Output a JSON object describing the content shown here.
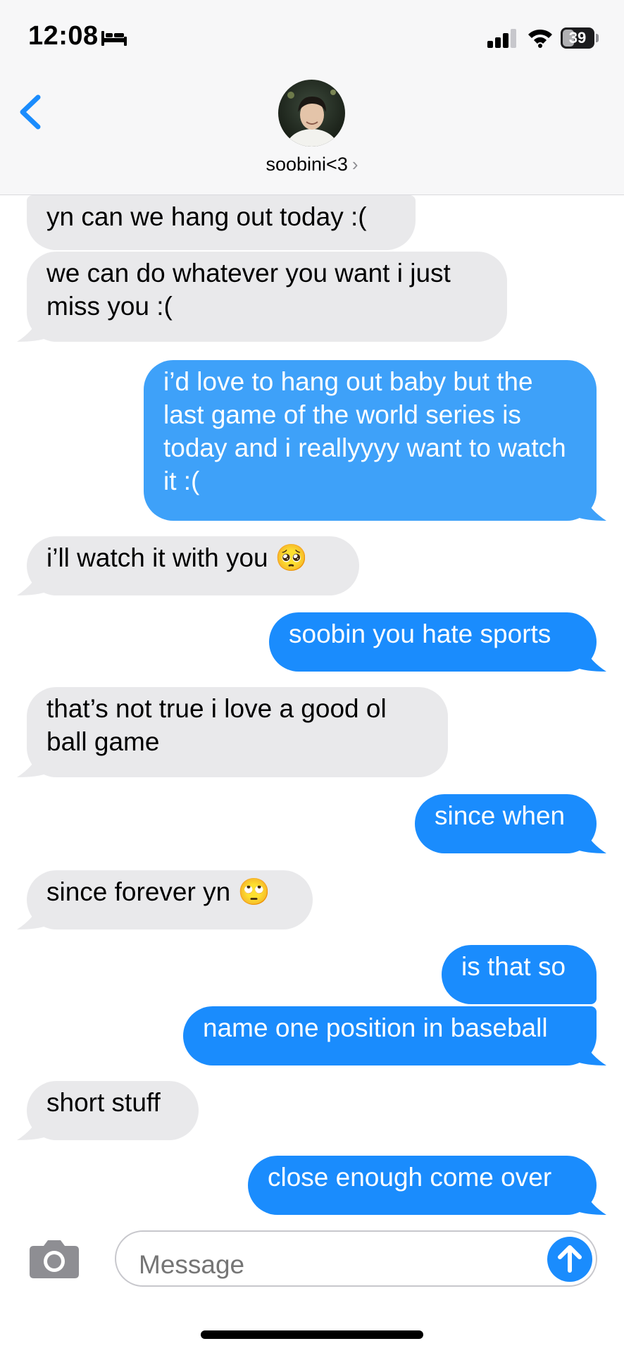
{
  "status_bar": {
    "time": "12:08",
    "battery": "39",
    "battery_level": 0.39
  },
  "header": {
    "contact_name": "soobini<3",
    "chevron": "›"
  },
  "messages": [
    {
      "side": "in",
      "text": "yn can we hang out today :("
    },
    {
      "side": "in",
      "text": "we can do whatever you want i just miss you :("
    },
    {
      "side": "out",
      "text": "i’d love to hang out baby but the last game of the world series is today and i reallyyyy want to watch it :("
    },
    {
      "side": "in",
      "text": "i’ll watch it with you",
      "emoji": "🥺",
      "emoji_name": "pleading-face"
    },
    {
      "side": "out",
      "text": "soobin you hate sports"
    },
    {
      "side": "in",
      "text": "that’s not true i love a good ol ball game"
    },
    {
      "side": "out",
      "text": "since when"
    },
    {
      "side": "in",
      "text": "since forever yn",
      "emoji": "🙄",
      "emoji_name": "eye-roll-face"
    },
    {
      "side": "out",
      "text": "is that so"
    },
    {
      "side": "out",
      "text": "name one position in baseball"
    },
    {
      "side": "in",
      "text": "short stuff"
    },
    {
      "side": "out",
      "text": "close enough come over"
    }
  ],
  "composer": {
    "placeholder": "Message"
  },
  "icons": {
    "back": "chevron-left-icon",
    "camera": "camera-icon",
    "send": "arrow-up-icon",
    "signal": "cellular-signal-icon",
    "wifi": "wifi-icon",
    "sleep": "bed-icon"
  },
  "colors": {
    "outgoing_bubble": "#1a8cfd",
    "incoming_bubble": "#e9e9eb",
    "accent": "#1a8cfd",
    "header_bg": "#f7f7f8"
  }
}
